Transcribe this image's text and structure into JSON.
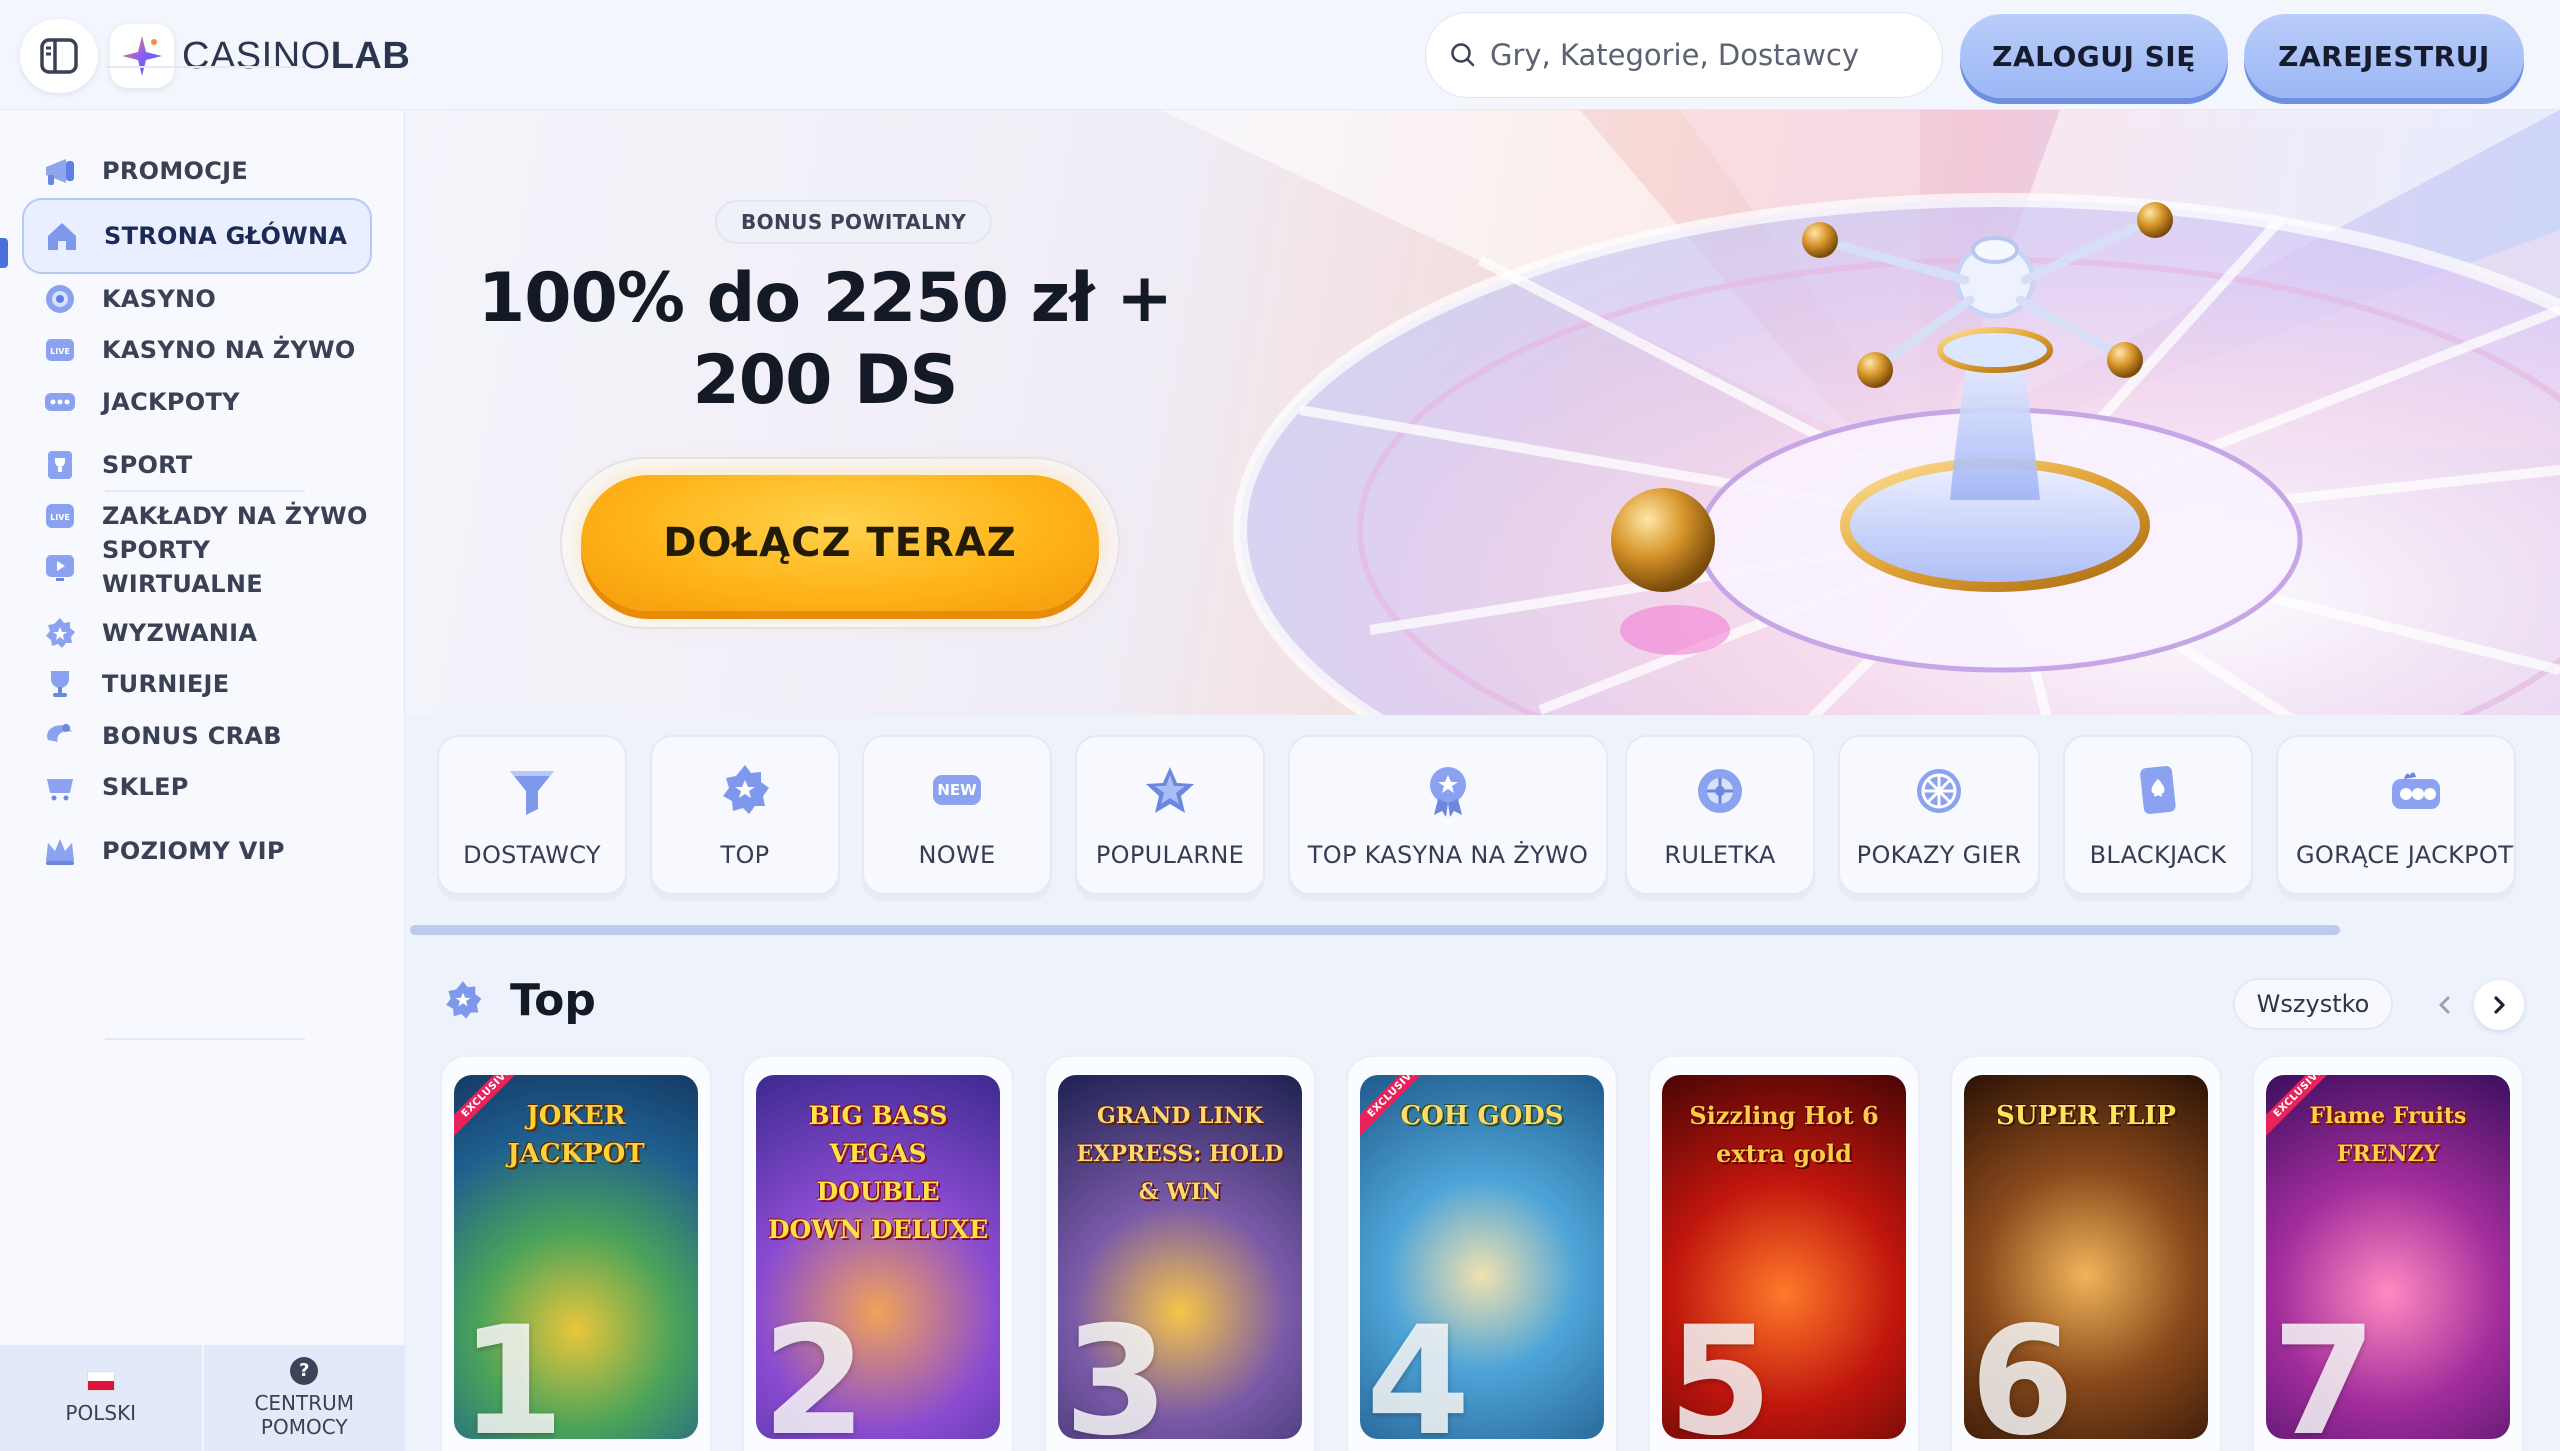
{
  "header": {
    "logo_light": "CASINO",
    "logo_bold": "LAB",
    "search_placeholder": "Gry, Kategorie, Dostawcy",
    "login_label": "ZALOGUJ SIĘ",
    "register_label": "ZAREJESTRUJ"
  },
  "sidebar": {
    "items": [
      {
        "label": "PROMOCJE",
        "icon": "megaphone-icon"
      },
      {
        "label": "STRONA GŁÓWNA",
        "icon": "home-icon",
        "active": true
      },
      {
        "label": "KASYNO",
        "icon": "chip-icon"
      },
      {
        "label": "KASYNO NA ŻYWO",
        "icon": "live-icon"
      },
      {
        "label": "JACKPOTY",
        "icon": "jackpot-icon"
      },
      {
        "label": "SPORT",
        "icon": "trophy-card-icon"
      },
      {
        "label": "ZAKŁADY NA ŻYWO",
        "icon": "live-bet-icon"
      },
      {
        "label": "SPORTY WIRTUALNE",
        "icon": "virtual-sport-icon"
      },
      {
        "label": "WYZWANIA",
        "icon": "challenge-icon"
      },
      {
        "label": "TURNIEJE",
        "icon": "cup-icon"
      },
      {
        "label": "BONUS CRAB",
        "icon": "crab-icon"
      },
      {
        "label": "SKLEP",
        "icon": "shop-icon"
      },
      {
        "label": "POZIOMY VIP",
        "icon": "crown-icon"
      }
    ],
    "language": "POLSKI",
    "help_line1": "CENTRUM",
    "help_line2": "POMOCY"
  },
  "hero": {
    "badge": "BONUS POWITALNY",
    "title_line1": "100% do 2250 zł +",
    "title_line2": "200 DS",
    "cta": "DOŁĄCZ TERAZ"
  },
  "categories": [
    {
      "label": "DOSTAWCY",
      "icon": "funnel-icon"
    },
    {
      "label": "TOP",
      "icon": "star-badge-icon"
    },
    {
      "label": "NOWE",
      "icon": "new-badge-icon"
    },
    {
      "label": "POPULARNE",
      "icon": "star-icon"
    },
    {
      "label": "TOP KASYNA NA ŻYWO",
      "icon": "medal-icon"
    },
    {
      "label": "RULETKA",
      "icon": "roulette-icon"
    },
    {
      "label": "POKAZY GIER",
      "icon": "wheel-icon"
    },
    {
      "label": "BLACKJACK",
      "icon": "card-icon"
    },
    {
      "label": "GORĄCE JACKPOTY",
      "icon": "coins-icon"
    }
  ],
  "top_section": {
    "title": "Top",
    "all_label": "Wszystko"
  },
  "games": [
    {
      "rank": "1",
      "title": "JOKER JACKPOT",
      "exclusive": "EXCLUSIVE"
    },
    {
      "rank": "2",
      "title": "BIG BASS VEGAS DOUBLE DOWN DELUXE",
      "exclusive": ""
    },
    {
      "rank": "3",
      "title": "GRAND LINK EXPRESS: HOLD & WIN",
      "exclusive": ""
    },
    {
      "rank": "4",
      "title": "COH GODS",
      "exclusive": "EXCLUSIVE"
    },
    {
      "rank": "5",
      "title": "Sizzling Hot 6 extra gold",
      "exclusive": ""
    },
    {
      "rank": "6",
      "title": "SUPER FLIP",
      "exclusive": ""
    },
    {
      "rank": "7",
      "title": "Flame Fruits FRENZY",
      "exclusive": "EXCLUSIVE"
    }
  ],
  "colors": {
    "accent": "#9bb7f5",
    "cta": "#ffb51a",
    "background": "#eef2fb"
  }
}
